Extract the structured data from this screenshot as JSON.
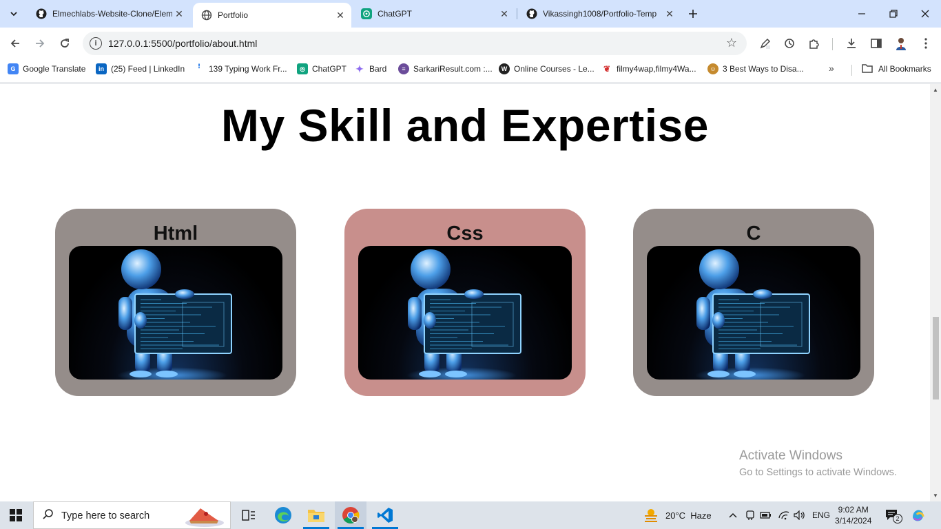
{
  "browser": {
    "tabs": [
      {
        "title": "Elmechlabs-Website-Clone/Elem",
        "icon": "github-icon"
      },
      {
        "title": "Portfolio",
        "icon": "globe-icon",
        "active": true
      },
      {
        "title": "ChatGPT",
        "icon": "chatgpt-icon"
      },
      {
        "title": "Vikassingh1008/Portfolio-Temp",
        "icon": "github-icon"
      }
    ],
    "url": "127.0.0.1:5500/portfolio/about.html",
    "bookmarks": [
      {
        "label": "Google Translate",
        "color": "#4285f4"
      },
      {
        "label": "(25) Feed | LinkedIn",
        "color": "#0a66c2"
      },
      {
        "label": "139 Typing Work Fr...",
        "color": "#1a73e8"
      },
      {
        "label": "ChatGPT",
        "color": "#10a37f"
      },
      {
        "label": "Bard",
        "color": "#8e6cef"
      },
      {
        "label": "SarkariResult.com :...",
        "color": "#6b4c9a"
      },
      {
        "label": "Online Courses - Le...",
        "color": "#222222"
      },
      {
        "label": "filmy4wap,filmy4Wa...",
        "color": "#d32f2f"
      },
      {
        "label": "3 Best Ways to Disa...",
        "color": "#c58a2e"
      }
    ],
    "all_bookmarks_label": "All Bookmarks"
  },
  "page": {
    "heading": "My Skill and Expertise",
    "cards": [
      {
        "title": "Html",
        "bg": "#958d8a"
      },
      {
        "title": "Css",
        "bg": "#c88f8c"
      },
      {
        "title": "C",
        "bg": "#958d8a"
      }
    ]
  },
  "watermark": {
    "line1": "Activate Windows",
    "line2": "Go to Settings to activate Windows."
  },
  "taskbar": {
    "search_placeholder": "Type here to search",
    "weather": "20°C  Haze",
    "language": "ENG",
    "time": "9:02 AM",
    "date": "3/14/2024",
    "notifications": "2"
  }
}
